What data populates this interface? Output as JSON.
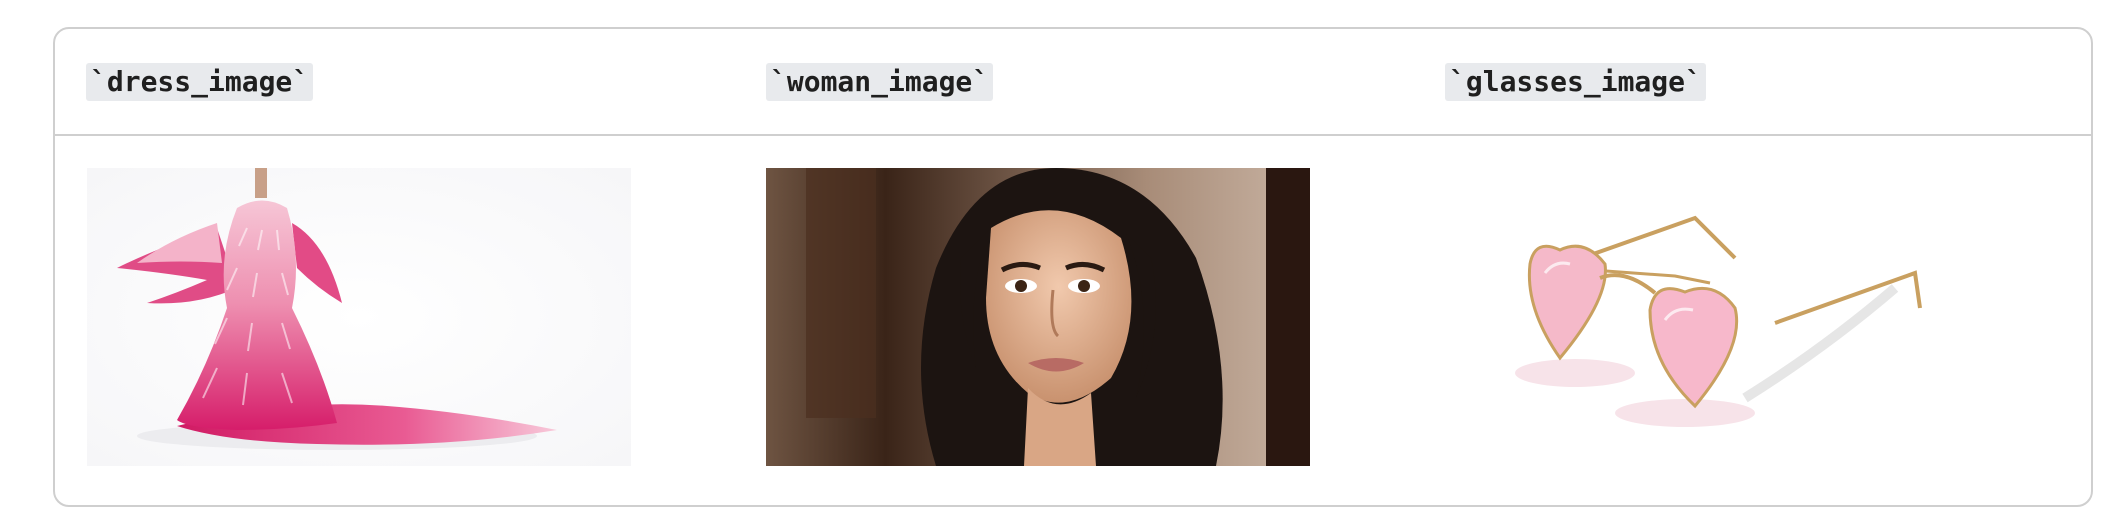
{
  "columns": [
    {
      "header": "`dress_image`",
      "image": "pink-feathered-gown-photo"
    },
    {
      "header": "`woman_image`",
      "image": "dark-haired-woman-portrait-photo"
    },
    {
      "header": "`glasses_image`",
      "image": "pink-heart-sunglasses-photo"
    }
  ],
  "colors": {
    "border": "#cfcfcf",
    "code_bg": "#e8eaed",
    "text": "#1f1f1f"
  }
}
